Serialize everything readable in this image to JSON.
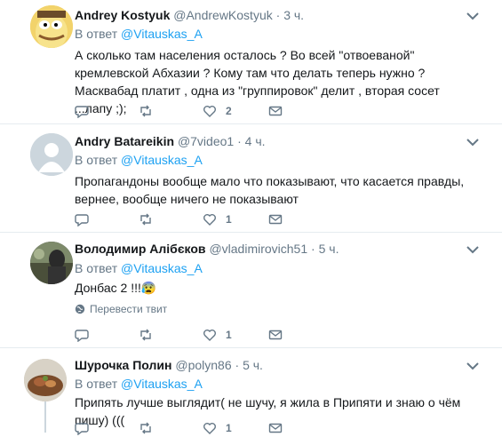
{
  "colors": {
    "link": "#1da1f2",
    "muted": "#657786",
    "text": "#14171a",
    "divider": "#e6ecf0"
  },
  "tweets": [
    {
      "name": "Andrey Kostyuk",
      "handle": "@AndrewKostyuk",
      "dot": "·",
      "time": "3 ч.",
      "reply_prefix": "В ответ",
      "reply_to": "@Vitauskas_A",
      "text": "А сколько там населения осталось ? Во всей \"отвоеваной\" кремлевской Абхазии ? Кому там что делать теперь нужно ? Масквабад платит , одна из \"группировок\" делит , вторая сосет ...лапу ;);",
      "likes": "2",
      "avatar": "cartoon-avatar"
    },
    {
      "name": "Andry Batareikin",
      "handle": "@7video1",
      "dot": "·",
      "time": "4 ч.",
      "reply_prefix": "В ответ",
      "reply_to": "@Vitauskas_A",
      "text": "Пропагандоны вообще мало что показывают, что касается правды, вернее, вообще ничего не показывают",
      "likes": "1",
      "avatar": "default-avatar"
    },
    {
      "name": "Володимир Алібєков",
      "handle": "@vladimirovich51",
      "dot": "·",
      "time": "5 ч.",
      "reply_prefix": "В ответ",
      "reply_to": "@Vitauskas_A",
      "text": "Донбас 2 !!!",
      "emoji": "😰",
      "translate": "Перевести твит",
      "likes": "1",
      "avatar": "photo-avatar"
    },
    {
      "name": "Шурочка Полин",
      "handle": "@polyn86",
      "dot": "·",
      "time": "5 ч.",
      "reply_prefix": "В ответ",
      "reply_to": "@Vitauskas_A",
      "text": "Припять лучше выглядит( не шучу, я жила в Припяти и знаю о чём пишу) (((",
      "likes": "1",
      "avatar": "food-avatar"
    }
  ]
}
